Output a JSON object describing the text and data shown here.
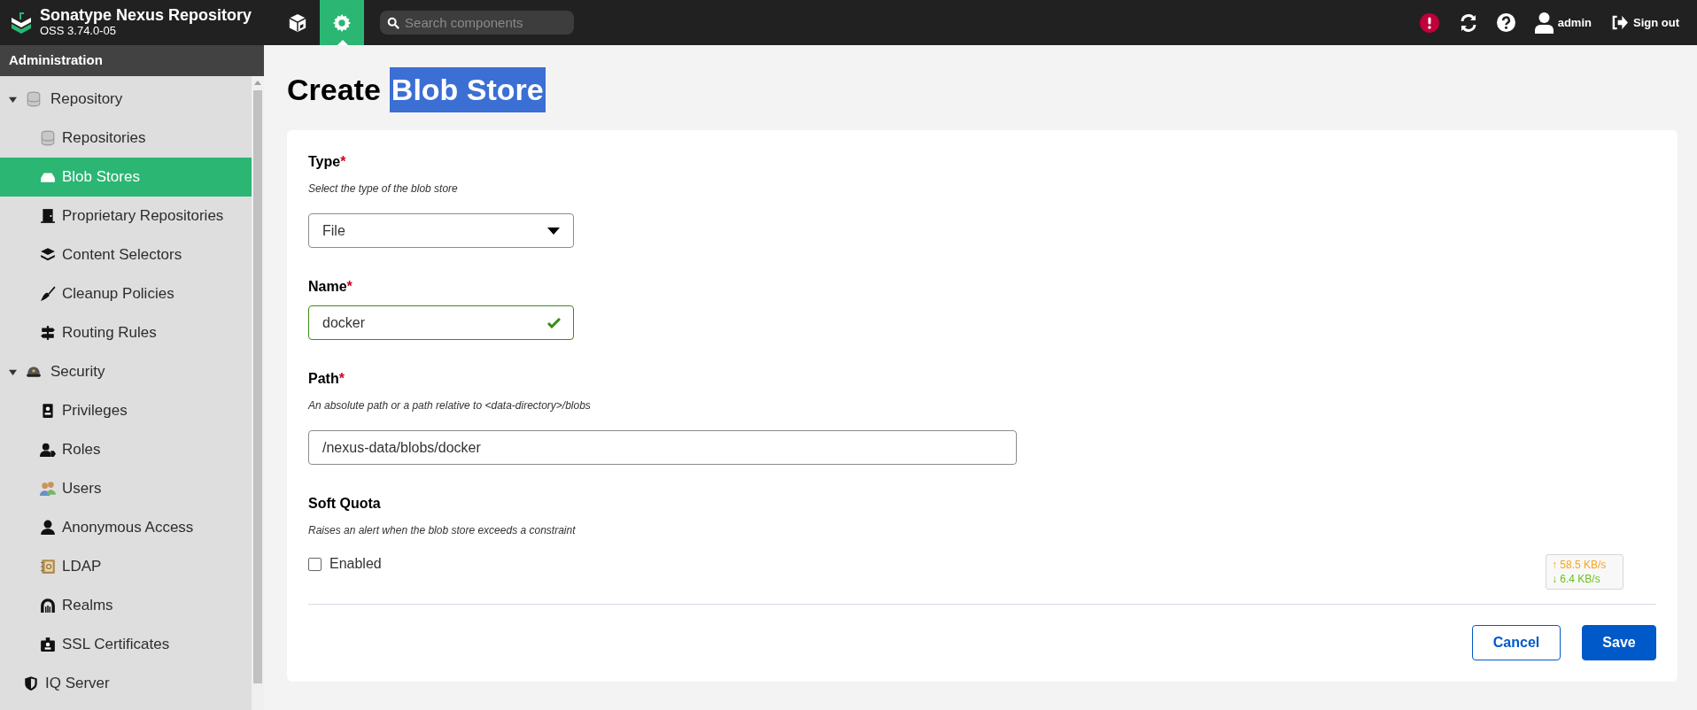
{
  "header": {
    "brand": {
      "title": "Sonatype Nexus Repository",
      "version": "OSS 3.74.0-05"
    },
    "nav_tabs": [
      {
        "kind": "browse",
        "selected": false
      },
      {
        "kind": "admin",
        "selected": true
      }
    ],
    "search": {
      "placeholder": "Search components"
    },
    "user": {
      "name": "admin"
    },
    "sign_out": {
      "label": "Sign out"
    }
  },
  "sidebar": {
    "title": "Administration",
    "items": [
      {
        "label": "Repository",
        "expanded": true,
        "selected": false,
        "children": [
          {
            "label": "Repositories",
            "selected": false
          },
          {
            "label": "Blob Stores",
            "selected": true
          },
          {
            "label": "Proprietary Repositories",
            "selected": false
          },
          {
            "label": "Content Selectors",
            "selected": false
          },
          {
            "label": "Cleanup Policies",
            "selected": false
          },
          {
            "label": "Routing Rules",
            "selected": false
          }
        ]
      },
      {
        "label": "Security",
        "expanded": true,
        "selected": false,
        "children": [
          {
            "label": "Privileges",
            "selected": false
          },
          {
            "label": "Roles",
            "selected": false
          },
          {
            "label": "Users",
            "selected": false
          },
          {
            "label": "Anonymous Access",
            "selected": false
          },
          {
            "label": "LDAP",
            "selected": false
          },
          {
            "label": "Realms",
            "selected": false
          },
          {
            "label": "SSL Certificates",
            "selected": false
          }
        ]
      },
      {
        "label": "IQ Server",
        "selected": false
      }
    ]
  },
  "page": {
    "title": "Create",
    "title_highlighted": "Blob Store"
  },
  "form": {
    "fields": [
      {
        "kind": "select",
        "label": "Type",
        "required_mark": "*",
        "hint": "Select the type of the blob store",
        "value": "File"
      },
      {
        "kind": "text",
        "label": "Name",
        "required_mark": "*",
        "value": "docker",
        "valid": true
      },
      {
        "kind": "wide_text",
        "label": "Path",
        "required_mark": "*",
        "hint": "An absolute path or a path relative to <data-directory>/blobs",
        "value": "/nexus-data/blobs/docker"
      },
      {
        "kind": "checkbox",
        "label": "Soft Quota",
        "hint": "Raises an alert when the blob store exceeds a constraint",
        "option": "Enabled",
        "checked": false
      }
    ],
    "buttons": [
      {
        "kind": "secondary",
        "label": "Cancel"
      },
      {
        "kind": "primary",
        "label": "Save"
      }
    ]
  },
  "speed_widget": {
    "upload": "↑ 58.5 KB/s",
    "download": "↓ 6.4 KB/s"
  }
}
